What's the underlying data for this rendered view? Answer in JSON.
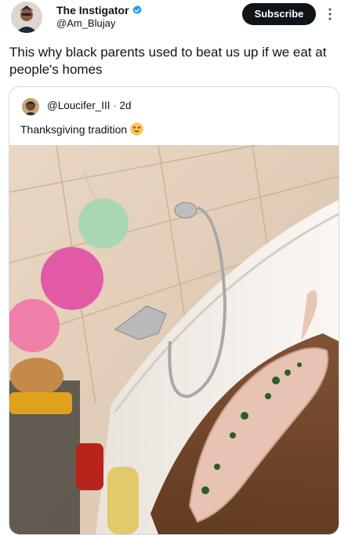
{
  "author": {
    "display_name": "The Instigator",
    "handle": "@Am_Blujay",
    "verified": true,
    "avatar_icon": "profile-avatar"
  },
  "actions": {
    "subscribe_label": "Subscribe",
    "more_icon": "more-vertical-icon"
  },
  "tweet": {
    "text": "This why black parents used to beat us up if we eat at people's homes"
  },
  "quote": {
    "handle": "@Loucifer_III",
    "separator": "·",
    "time": "2d",
    "text": "Thanksgiving tradition",
    "emoji_icon": "smiling-face-heart-eyes-emoji"
  },
  "colors": {
    "text": "#0f1419",
    "secondary": "#536471",
    "verified_blue": "#1d9bf0",
    "border": "#cfd9de",
    "button_bg": "#0f1419"
  }
}
